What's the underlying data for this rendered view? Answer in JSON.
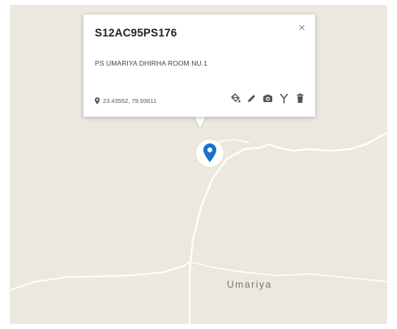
{
  "map": {
    "place_label": "Umariya",
    "background_color": "#ece8e0",
    "road_color": "#ffffff",
    "marker_color": "#1a73c8"
  },
  "popup": {
    "title": "S12AC95PS176",
    "close_symbol": "×",
    "description": "PS UMARIYA DHIRHA ROOM NU.1",
    "coordinates": "23.43552, 79.93611",
    "actions": [
      {
        "name": "paint-bucket-icon"
      },
      {
        "name": "pencil-icon"
      },
      {
        "name": "camera-icon"
      },
      {
        "name": "fork-icon"
      },
      {
        "name": "trash-icon"
      }
    ]
  }
}
